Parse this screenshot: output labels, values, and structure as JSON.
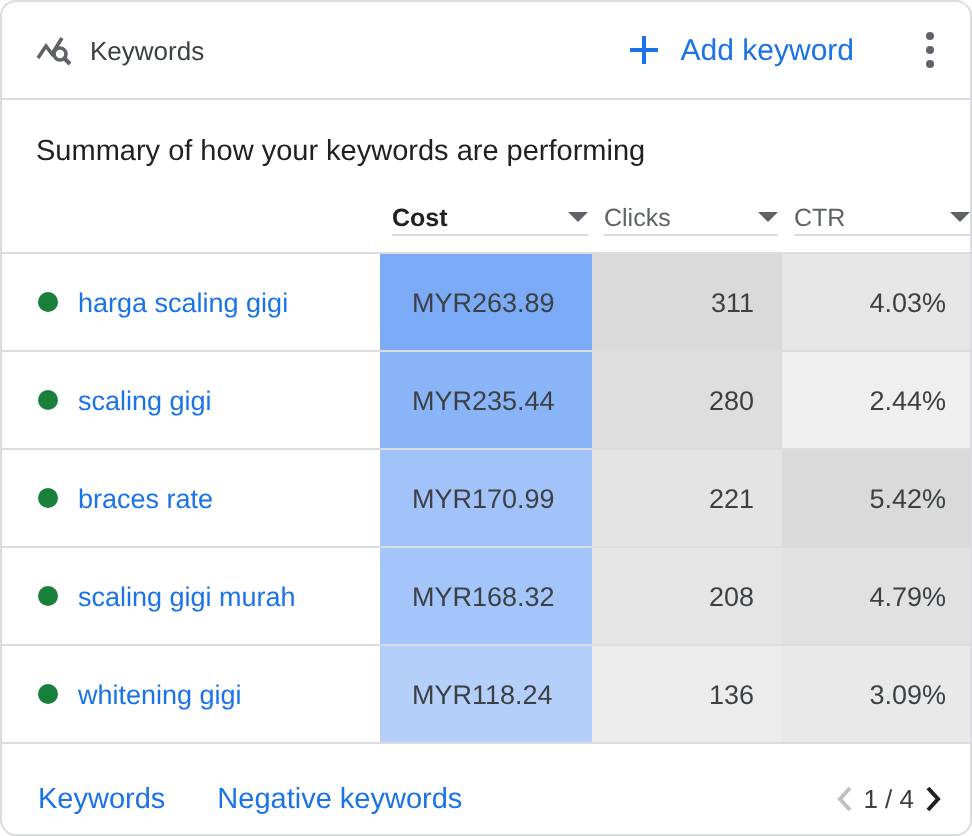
{
  "header": {
    "title": "Keywords",
    "action": "Add keyword"
  },
  "summary": "Summary of how your keywords are performing",
  "columns": [
    {
      "label": "Cost",
      "selected": true
    },
    {
      "label": "Clicks",
      "selected": false
    },
    {
      "label": "CTR",
      "selected": false
    }
  ],
  "rows": [
    {
      "keyword": "harga scaling gigi",
      "color": "#188038",
      "cells": [
        {
          "text": "MYR263.89",
          "color": "#7baaf7"
        },
        {
          "text": "311",
          "color": "#dadada"
        },
        {
          "text": "4.03%",
          "color": "#e6e6e6"
        }
      ]
    },
    {
      "keyword": "scaling gigi",
      "color": "#188038",
      "cells": [
        {
          "text": "MYR235.44",
          "color": "#8ab4f8"
        },
        {
          "text": "280",
          "color": "#dedede"
        },
        {
          "text": "2.44%",
          "color": "#efefef"
        }
      ]
    },
    {
      "keyword": "braces rate",
      "color": "#188038",
      "cells": [
        {
          "text": "MYR170.99",
          "color": "#a1c3f9"
        },
        {
          "text": "221",
          "color": "#e4e4e4"
        },
        {
          "text": "5.42%",
          "color": "#dadada"
        }
      ]
    },
    {
      "keyword": "scaling gigi murah",
      "color": "#188038",
      "cells": [
        {
          "text": "MYR168.32",
          "color": "#a3c5f9"
        },
        {
          "text": "208",
          "color": "#e5e5e5"
        },
        {
          "text": "4.79%",
          "color": "#e1e1e1"
        }
      ]
    },
    {
      "keyword": "whitening gigi",
      "color": "#188038",
      "cells": [
        {
          "text": "MYR118.24",
          "color": "#b3cffa"
        },
        {
          "text": "136",
          "color": "#ececec"
        },
        {
          "text": "3.09%",
          "color": "#e9e9e9"
        }
      ]
    }
  ],
  "footer": {
    "links": [
      "Keywords",
      "Negative keywords"
    ],
    "page": "1 / 4",
    "prev_disabled": true,
    "next_disabled": false
  }
}
